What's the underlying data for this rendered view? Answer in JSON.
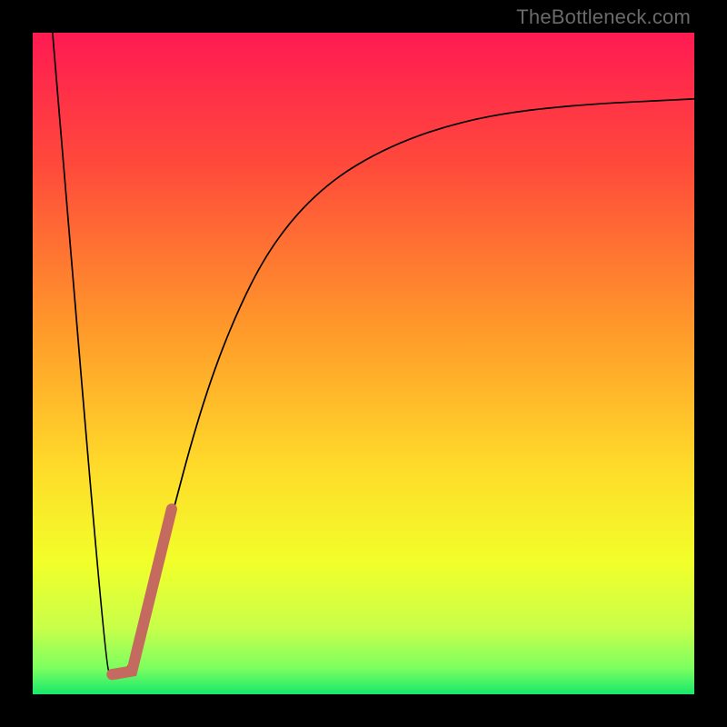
{
  "watermark": "TheBottleneck.com",
  "chart_data": {
    "type": "line",
    "title": "",
    "xlabel": "",
    "ylabel": "",
    "xlim": [
      0,
      100
    ],
    "ylim": [
      0,
      100
    ],
    "grid": false,
    "legend": false,
    "gradient_stops": [
      {
        "offset": 0.0,
        "color": "#ff1a52"
      },
      {
        "offset": 0.2,
        "color": "#ff4a3b"
      },
      {
        "offset": 0.45,
        "color": "#ff9a2a"
      },
      {
        "offset": 0.65,
        "color": "#ffd92a"
      },
      {
        "offset": 0.8,
        "color": "#f2ff2a"
      },
      {
        "offset": 0.9,
        "color": "#c8ff4a"
      },
      {
        "offset": 0.96,
        "color": "#7dff60"
      },
      {
        "offset": 1.0,
        "color": "#17e86b"
      }
    ],
    "series": [
      {
        "name": "bottleneck-curve",
        "color": "#000000",
        "width": 1.4,
        "points": [
          {
            "x": 3,
            "y": 100
          },
          {
            "x": 11,
            "y": 4
          },
          {
            "x": 12,
            "y": 3
          },
          {
            "x": 14,
            "y": 3
          },
          {
            "x": 16,
            "y": 8
          },
          {
            "x": 20,
            "y": 23
          },
          {
            "x": 25,
            "y": 42
          },
          {
            "x": 30,
            "y": 56
          },
          {
            "x": 36,
            "y": 68
          },
          {
            "x": 44,
            "y": 77
          },
          {
            "x": 54,
            "y": 83
          },
          {
            "x": 66,
            "y": 87
          },
          {
            "x": 80,
            "y": 89
          },
          {
            "x": 100,
            "y": 90
          }
        ]
      },
      {
        "name": "highlight-segment",
        "color": "#c46a5f",
        "width": 10,
        "linecap": "round",
        "points": [
          {
            "x": 12,
            "y": 3
          },
          {
            "x": 15,
            "y": 3.5
          },
          {
            "x": 21,
            "y": 28
          }
        ]
      }
    ]
  }
}
